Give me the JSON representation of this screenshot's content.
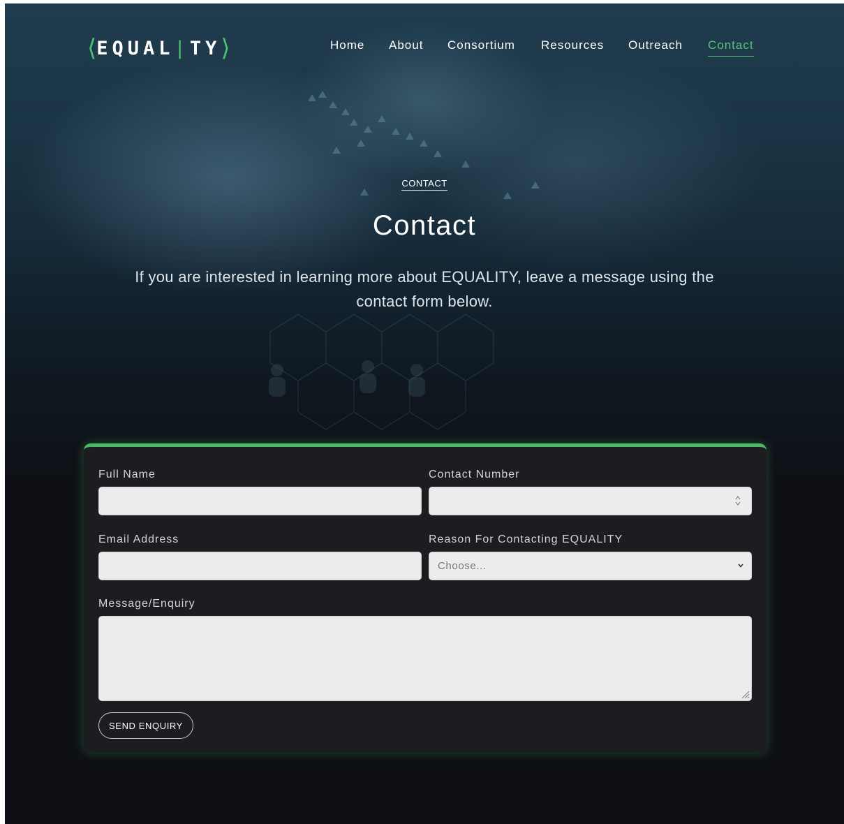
{
  "header": {
    "logo_prefix": "EQUAL",
    "logo_suffix": "TY",
    "nav": [
      {
        "label": "Home",
        "active": false
      },
      {
        "label": "About",
        "active": false
      },
      {
        "label": "Consortium",
        "active": false
      },
      {
        "label": "Resources",
        "active": false
      },
      {
        "label": "Outreach",
        "active": false
      },
      {
        "label": "Contact",
        "active": true
      }
    ]
  },
  "hero": {
    "eyebrow": "CONTACT",
    "title": "Contact",
    "subtitle": "If you are interested in learning more about EQUALITY, leave a message using the contact form below."
  },
  "form": {
    "full_name_label": "Full Name",
    "full_name_value": "",
    "contact_number_label": "Contact Number",
    "contact_number_value": "",
    "email_label": "Email Address",
    "email_value": "",
    "reason_label": "Reason For Contacting EQUALITY",
    "reason_selected": "Choose...",
    "message_label": "Message/Enquiry",
    "message_value": "",
    "submit_label": "SEND ENQUIRY"
  },
  "colors": {
    "accent": "#4cb862",
    "nav_active": "#57c27a",
    "page_background": "#0e1015",
    "card_background": "#1c1d21",
    "field_background": "#ececec"
  },
  "icons": {
    "stepper": "number-stepper-icon",
    "select": "chevron-down-icon",
    "resize": "resize-grip-icon"
  }
}
